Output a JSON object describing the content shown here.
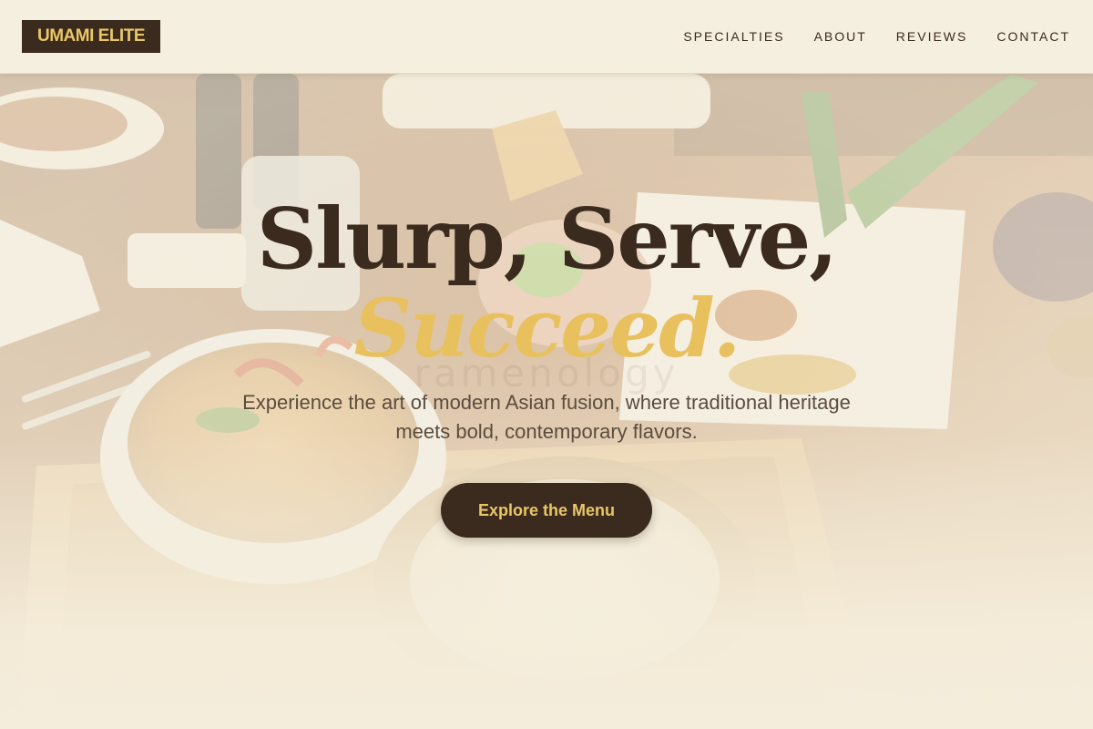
{
  "brand": {
    "name": "UMAMI ELITE"
  },
  "nav": {
    "links": [
      {
        "label": "SPECIALTIES"
      },
      {
        "label": "ABOUT"
      },
      {
        "label": "REVIEWS"
      },
      {
        "label": "CONTACT"
      }
    ]
  },
  "hero": {
    "headline_line1": "Slurp, Serve,",
    "headline_line2": "Succeed.",
    "background_watermark": "ramenology",
    "subtitle": "Experience the art of modern Asian fusion, where traditional heritage meets bold, contemporary flavors.",
    "cta_label": "Explore the Menu",
    "background_image": "asian-food-table-photo"
  },
  "colors": {
    "primary_dark": "#3b2a1e",
    "accent_gold": "#e8c15e",
    "background_cream": "#f3ecd9",
    "text_muted": "#5c4c3e"
  }
}
